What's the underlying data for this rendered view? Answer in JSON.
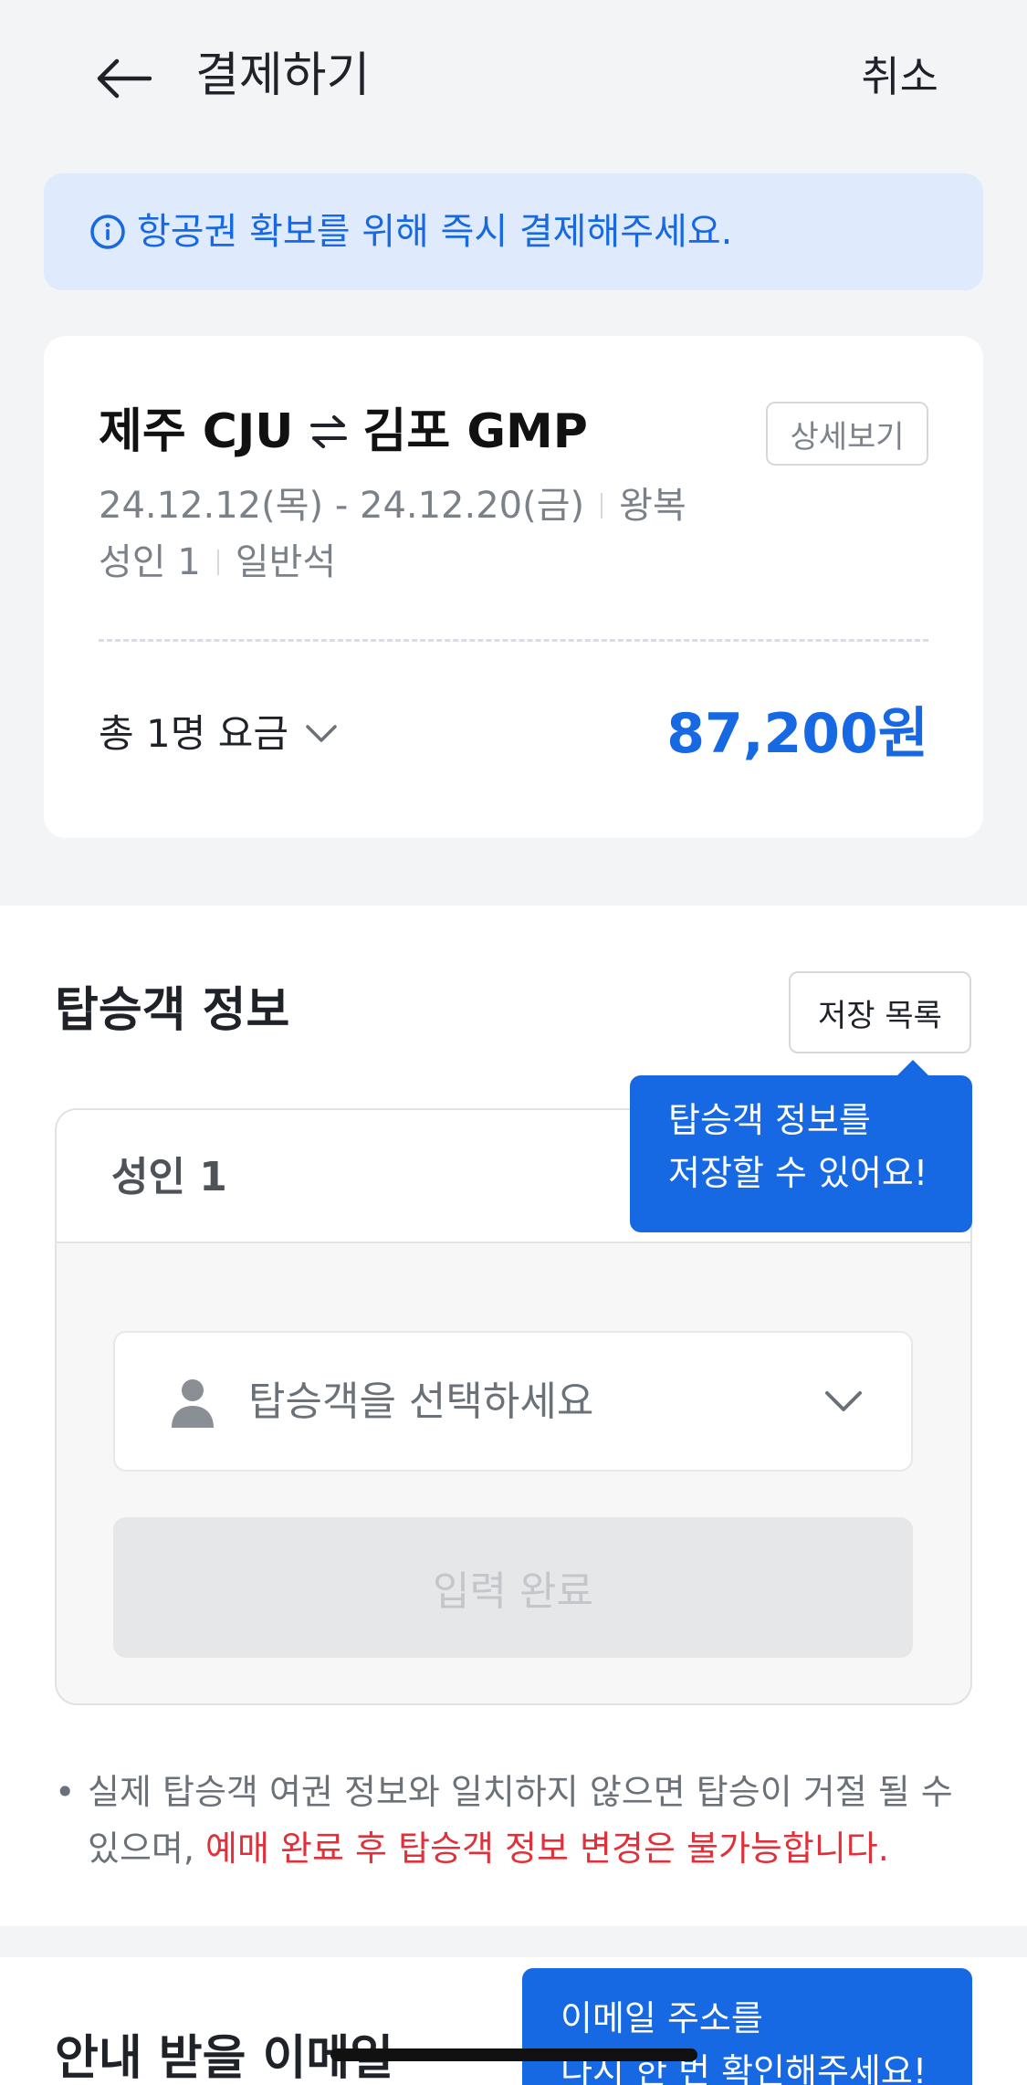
{
  "header": {
    "title": "결제하기",
    "cancel_label": "취소",
    "back_icon": "arrow-left-icon"
  },
  "notice": {
    "icon": "info-icon",
    "text": "항공권 확보를 위해 즉시 결제해주세요."
  },
  "flight": {
    "origin": "제주 CJU",
    "destination": "김포 GMP",
    "swap_icon": "round-trip-icon",
    "detail_label": "상세보기",
    "dates": "24.12.12(목) - 24.12.20(금)",
    "trip_type": "왕복",
    "passengers": "성인 1",
    "cabin": "일반석",
    "fare_label": "총 1명 요금",
    "fare_value": "87,200원"
  },
  "passenger_section": {
    "title": "탑승객 정보",
    "saved_list_label": "저장 목록",
    "tooltip": [
      "탑승객 정보를",
      "저장할 수 있어요!"
    ],
    "box_title": "성인 1",
    "select_placeholder": "탑승객을 선택하세요",
    "done_label": "입력 완료",
    "note_normal": "실제 탑승객 여권 정보와 일치하지 않으면 탑승이 거절 될 수 있으며, ",
    "note_warning": "예매 완료 후 탑승객 정보 변경은 불가능합니다."
  },
  "email_section": {
    "title": "안내 받을 이메일",
    "tooltip": [
      "이메일 주소를",
      "다시 한 번 확인해주세요!"
    ]
  },
  "colors": {
    "accent": "#1668e3",
    "warning": "#e0313b",
    "notice_bg": "#dfeafc",
    "page_bg": "#f3f4f6"
  }
}
